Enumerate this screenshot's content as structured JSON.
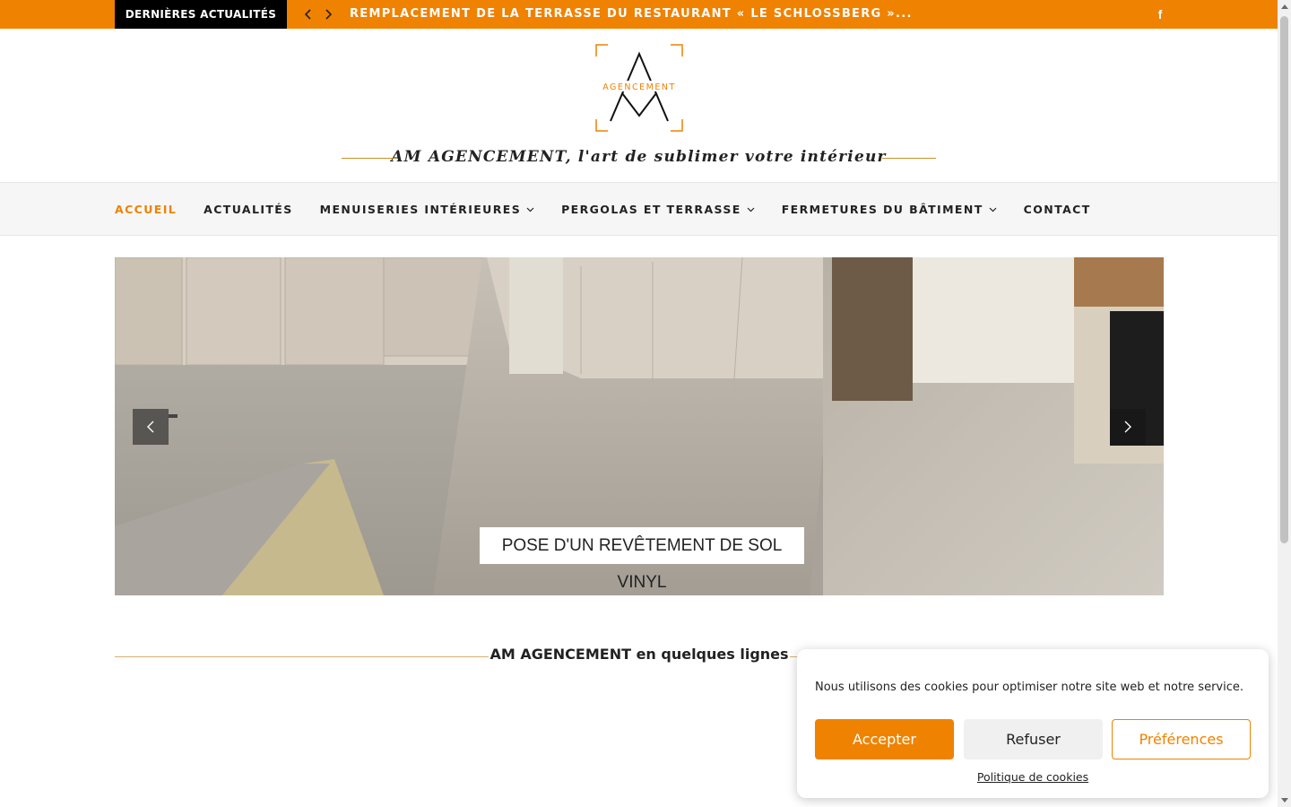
{
  "topbar": {
    "label": "DERNIÈRES ACTUALITÉS",
    "headline": "REMPLACEMENT DE LA TERRASSE DU RESTAURANT « LE SCHLOSSBERG »...",
    "prev_icon": "chevron-left-icon",
    "next_icon": "chevron-right-icon",
    "social_icon": "facebook-icon",
    "social_glyph": "f"
  },
  "header": {
    "logo_text": "AGENCEMENT",
    "tagline": "AM AGENCEMENT, l'art de sublimer votre intérieur"
  },
  "nav": {
    "items": [
      {
        "label": "ACCUEIL",
        "active": true,
        "dropdown": false
      },
      {
        "label": "ACTUALITÉS",
        "active": false,
        "dropdown": false
      },
      {
        "label": "MENUISERIES INTÉRIEURES",
        "active": false,
        "dropdown": true
      },
      {
        "label": "PERGOLAS ET TERRASSE",
        "active": false,
        "dropdown": true
      },
      {
        "label": "FERMETURES DU BÂTIMENT",
        "active": false,
        "dropdown": true
      },
      {
        "label": "CONTACT",
        "active": false,
        "dropdown": false
      }
    ]
  },
  "slider": {
    "caption": "POSE D'UN REVÊTEMENT DE SOL VINYL",
    "prev_icon": "chevron-left-icon",
    "next_icon": "chevron-right-icon"
  },
  "section": {
    "title": "AM AGENCEMENT en quelques lignes"
  },
  "cookie": {
    "message": "Nous utilisons des cookies pour optimiser notre site web et notre service.",
    "accept": "Accepter",
    "refuse": "Refuser",
    "preferences": "Préférences",
    "policy": "Politique de cookies"
  },
  "colors": {
    "accent": "#ef8200",
    "topbar_label_bg": "#000000",
    "nav_bg": "#f6f6f6",
    "divider_gold": "#c8902a"
  }
}
